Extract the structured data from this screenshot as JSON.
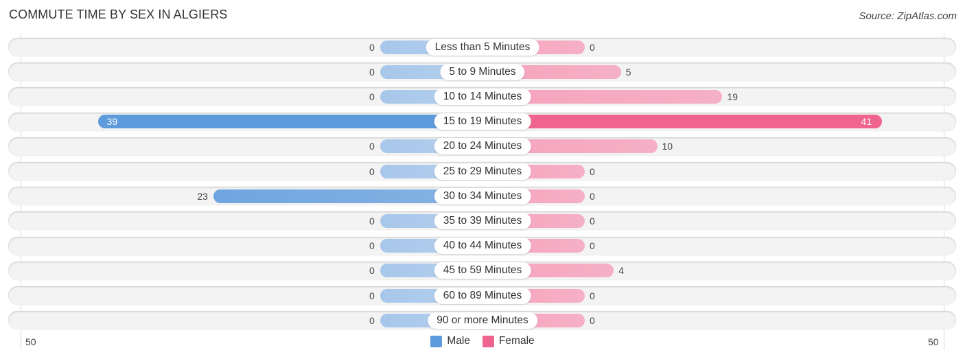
{
  "chart_data": {
    "type": "bar",
    "orientation": "horizontal-diverging",
    "title": "COMMUTE TIME BY SEX IN ALGIERS",
    "source": "Source: ZipAtlas.com",
    "categories": [
      "Less than 5 Minutes",
      "5 to 9 Minutes",
      "10 to 14 Minutes",
      "15 to 19 Minutes",
      "20 to 24 Minutes",
      "25 to 29 Minutes",
      "30 to 34 Minutes",
      "35 to 39 Minutes",
      "40 to 44 Minutes",
      "45 to 59 Minutes",
      "60 to 89 Minutes",
      "90 or more Minutes"
    ],
    "series": [
      {
        "name": "Male",
        "color": "#5e9bdc",
        "values": [
          0,
          0,
          0,
          39,
          0,
          0,
          23,
          0,
          0,
          0,
          0,
          0
        ]
      },
      {
        "name": "Female",
        "color": "#f06490",
        "values": [
          0,
          5,
          19,
          41,
          10,
          0,
          0,
          0,
          0,
          4,
          0,
          0
        ]
      }
    ],
    "axis": {
      "left_tick": "50",
      "right_tick": "50",
      "range": [
        -50,
        50
      ]
    },
    "legend": {
      "position": "bottom-center",
      "items": [
        "Male",
        "Female"
      ]
    },
    "grid": false
  }
}
